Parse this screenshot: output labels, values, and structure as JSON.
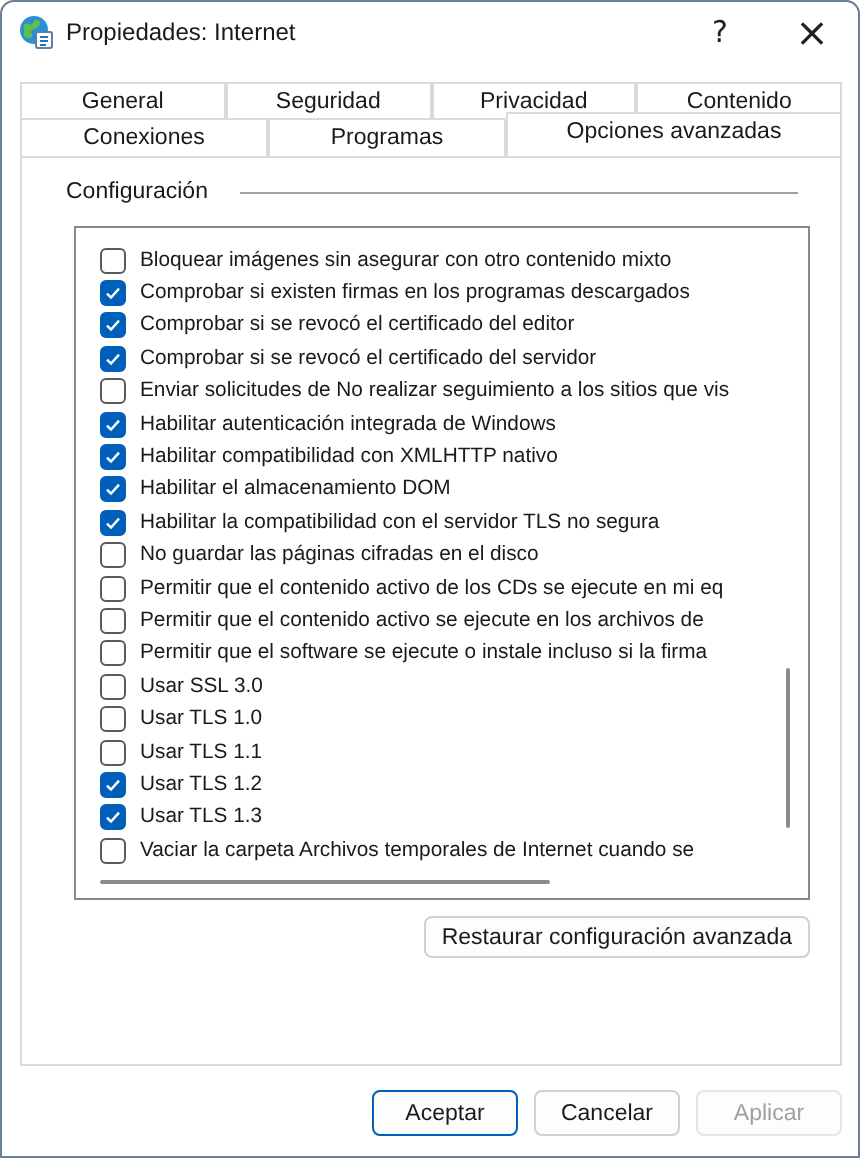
{
  "window": {
    "title": "Propiedades: Internet",
    "help": "?",
    "close": "×"
  },
  "tab_rows": [
    {
      "tabs": [
        {
          "label": "General",
          "selected": false
        },
        {
          "label": "Seguridad",
          "selected": false
        },
        {
          "label": "Privacidad",
          "selected": false
        },
        {
          "label": "Contenido",
          "selected": false
        }
      ]
    },
    {
      "tabs": [
        {
          "label": "Conexiones",
          "selected": false
        },
        {
          "label": "Programas",
          "selected": false
        },
        {
          "label": "Opciones avanzadas",
          "selected": true
        }
      ]
    }
  ],
  "settings": {
    "title": "Configuración",
    "items": [
      {
        "label": "Bloquear imágenes sin asegurar con otro contenido mixto",
        "checked": false
      },
      {
        "label": "Comprobar si existen firmas en los programas descargados",
        "checked": true
      },
      {
        "label": "Comprobar si se revocó el certificado del editor",
        "checked": true
      },
      {
        "label": "Comprobar si se revocó el certificado del servidor",
        "checked": true
      },
      {
        "label": "Enviar solicitudes de No realizar seguimiento a los sitios que vis",
        "checked": false
      },
      {
        "label": "Habilitar autenticación integrada de Windows",
        "checked": true
      },
      {
        "label": "Habilitar compatibilidad con XMLHTTP nativo",
        "checked": true
      },
      {
        "label": "Habilitar el almacenamiento DOM",
        "checked": true
      },
      {
        "label": "Habilitar la compatibilidad con el servidor TLS no segura",
        "checked": true
      },
      {
        "label": "No guardar las páginas cifradas en el disco",
        "checked": false
      },
      {
        "label": "Permitir que el contenido activo de los CDs se ejecute en mi eq",
        "checked": false
      },
      {
        "label": "Permitir que el contenido activo se ejecute en los archivos de",
        "checked": false
      },
      {
        "label": "Permitir que el software se ejecute o instale incluso si la firma",
        "checked": false
      },
      {
        "label": "Usar SSL 3.0",
        "checked": false
      },
      {
        "label": "Usar TLS 1.0",
        "checked": false
      },
      {
        "label": "Usar TLS 1.1",
        "checked": false
      },
      {
        "label": "Usar TLS 1.2",
        "checked": true
      },
      {
        "label": "Usar TLS 1.3",
        "checked": true
      },
      {
        "label": "Vaciar la carpeta Archivos temporales de Internet cuando se",
        "checked": false
      }
    ],
    "restore_button": "Restaurar configuración avanzada"
  },
  "buttons": [
    {
      "label": "Aceptar",
      "kind": "default",
      "disabled": false
    },
    {
      "label": "Cancelar",
      "kind": "normal",
      "disabled": false
    },
    {
      "label": "Aplicar",
      "kind": "normal",
      "disabled": true
    }
  ]
}
